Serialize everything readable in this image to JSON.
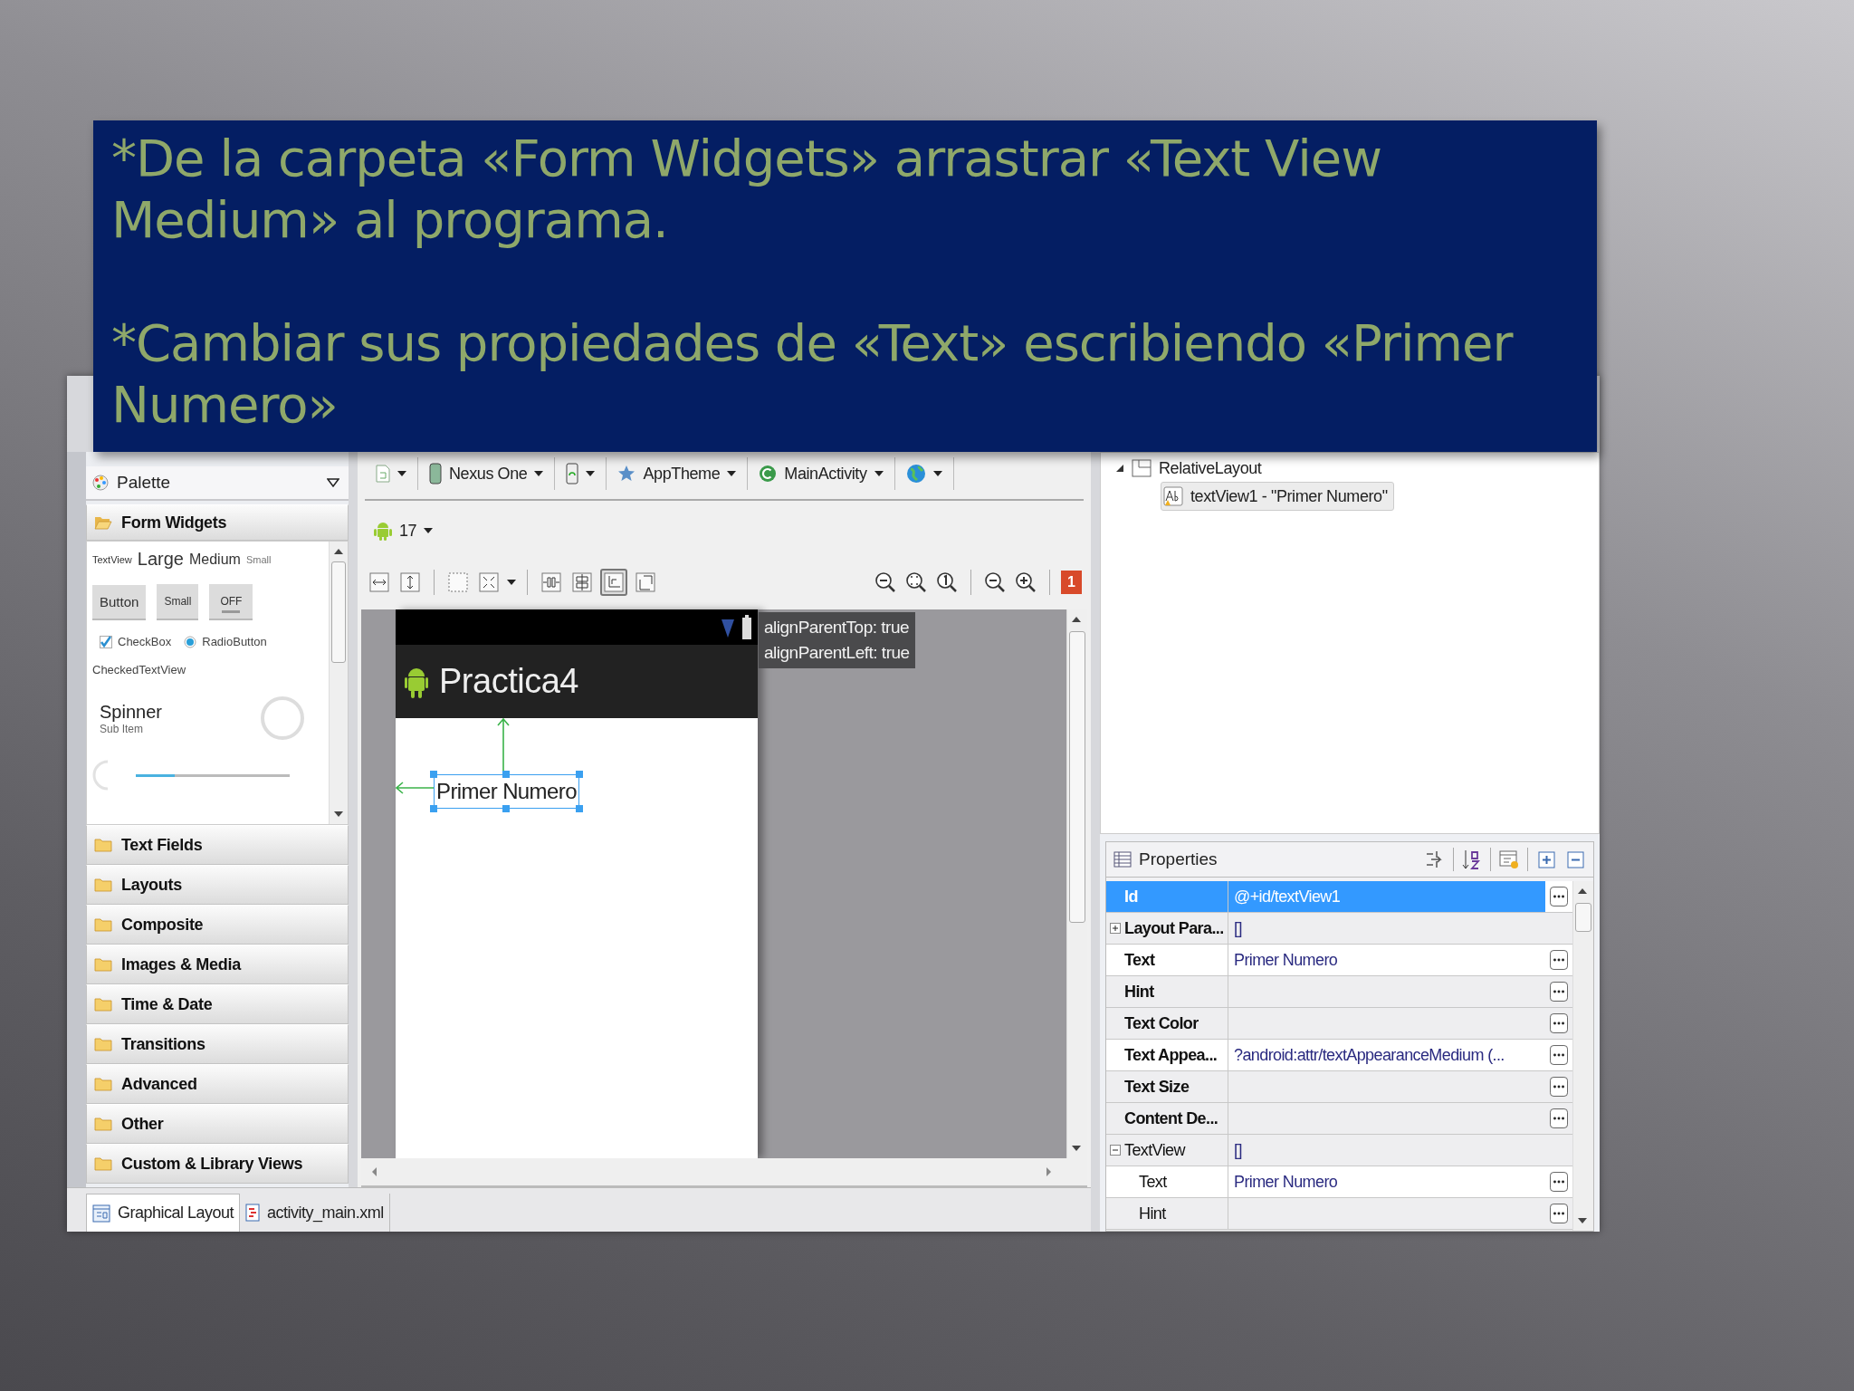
{
  "callout": {
    "paragraphs": [
      "*De la carpeta «Form Widgets» arrastrar «Text View Medium» al programa.",
      "*Cambiar sus propiedades de «Text» escribiendo «Primer Numero»"
    ]
  },
  "palette": {
    "title": "Palette",
    "open_folder": "Form Widgets",
    "text_samples": [
      {
        "text": "TextView",
        "kind": "tiny"
      },
      {
        "text": "Large",
        "kind": "large"
      },
      {
        "text": "Medium",
        "kind": "medium"
      },
      {
        "text": "Small",
        "kind": "small"
      }
    ],
    "buttons": [
      {
        "label": "Button",
        "kind": "button"
      },
      {
        "label": "Small",
        "kind": "small"
      },
      {
        "label": "OFF",
        "kind": "toggle"
      }
    ],
    "checkbox": {
      "label": "CheckBox",
      "checked": true
    },
    "radio": {
      "label": "RadioButton",
      "selected": true
    },
    "checked_text_view": "CheckedTextView",
    "spinner": {
      "label": "Spinner",
      "sub": "Sub Item"
    },
    "seekbar": {
      "level": 0.25
    },
    "categories": [
      "Text Fields",
      "Layouts",
      "Composite",
      "Images & Media",
      "Time & Date",
      "Transitions",
      "Advanced",
      "Other",
      "Custom & Library Views"
    ]
  },
  "editor": {
    "config": [
      {
        "kind": "file"
      },
      {
        "kind": "device",
        "label": "Nexus One"
      },
      {
        "kind": "orientation"
      },
      {
        "kind": "theme",
        "label": "AppTheme"
      },
      {
        "kind": "activity",
        "label": "MainActivity"
      },
      {
        "kind": "locale"
      }
    ],
    "api_level": "17",
    "layout_tools": [
      {
        "kind": "fill-width",
        "selected": false
      },
      {
        "kind": "fill-height",
        "selected": false
      },
      {
        "kind": "bounds",
        "selected": false
      },
      {
        "kind": "expand",
        "selected": false
      },
      {
        "kind": "distribute",
        "selected": false
      },
      {
        "kind": "center",
        "selected": false
      },
      {
        "kind": "anchor",
        "selected": true
      },
      {
        "kind": "clip",
        "selected": false
      }
    ],
    "error_count": "1",
    "app_title": "Practica4",
    "widget_text": "Primer Numero",
    "tooltip": [
      "alignParentTop: true",
      "alignParentLeft: true"
    ]
  },
  "bottom_tabs": [
    {
      "label": "Graphical Layout",
      "selected": true
    },
    {
      "label": "activity_main.xml",
      "selected": false
    }
  ],
  "outline": {
    "root": "RelativeLayout",
    "child": {
      "label": "textView1 - \"Primer Numero\"",
      "selected": true
    }
  },
  "properties": {
    "title": "Properties",
    "rows": [
      {
        "name": "Id",
        "value": "@+id/textView1",
        "kind": "property",
        "selected": true
      },
      {
        "name": "Layout Para...",
        "value": "[]",
        "kind": "group",
        "expanded": false,
        "selected": false
      },
      {
        "name": "Text",
        "value": "Primer Numero",
        "kind": "property",
        "selected": false
      },
      {
        "name": "Hint",
        "kind": "property",
        "selected": false
      },
      {
        "name": "Text Color",
        "kind": "property",
        "selected": false
      },
      {
        "name": "Text Appea...",
        "value": "?android:attr/textAppearanceMedium (...",
        "kind": "property",
        "selected": false
      },
      {
        "name": "Text Size",
        "kind": "property",
        "selected": false
      },
      {
        "name": "Content De...",
        "kind": "property",
        "selected": false
      },
      {
        "name": "TextView",
        "value": "[]",
        "kind": "category",
        "expanded": true,
        "selected": false
      },
      {
        "name": "Text",
        "value": "Primer Numero",
        "kind": "child",
        "selected": false
      },
      {
        "name": "Hint",
        "kind": "child",
        "selected": false
      }
    ]
  }
}
